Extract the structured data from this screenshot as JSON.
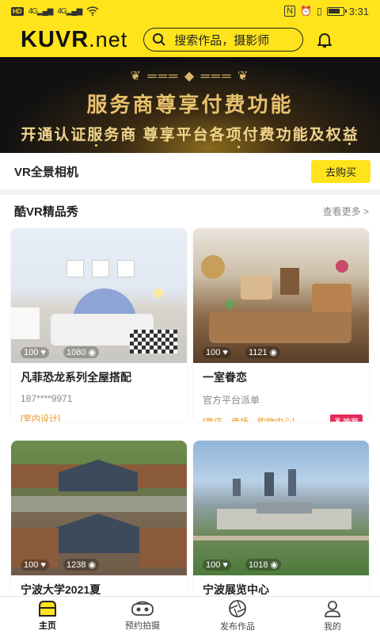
{
  "status_bar": {
    "hd": "HD",
    "signal1": "4G",
    "signal2": "4G",
    "time": "3:31"
  },
  "header": {
    "logo_main": "KUVR",
    "logo_suffix": ".net",
    "search_placeholder": "搜索作品，摄影师",
    "icons": {
      "search": "search-icon",
      "notification": "bell-icon"
    }
  },
  "banner": {
    "title": "服务商尊享付费功能",
    "subtitle": "开通认证服务商  尊享平台各项付费功能及权益"
  },
  "vr_camera": {
    "label": "VR全景相机",
    "button": "去购买"
  },
  "showcase": {
    "title": "酷VR精品秀",
    "more": "查看更多 >",
    "items": [
      {
        "name": "凡菲恐龙系列全屋搭配",
        "author": "187****9971",
        "tags": "[室内设计]",
        "likes": "100",
        "views": "1080",
        "recommended": false
      },
      {
        "name": "一室眷恋",
        "author": "官方平台派单",
        "tags": "[商店，商场，购物中心]",
        "likes": "100",
        "views": "1121",
        "recommended": true,
        "badge": "推荐"
      },
      {
        "name": "宁波大学2021夏",
        "likes": "100",
        "views": "1238"
      },
      {
        "name": "宁波展览中心",
        "likes": "100",
        "views": "1018"
      }
    ]
  },
  "nav": {
    "items": [
      {
        "label": "主页",
        "icon": "home-icon",
        "active": true
      },
      {
        "label": "预约拍摄",
        "icon": "vr-headset-icon",
        "active": false
      },
      {
        "label": "发布作品",
        "icon": "aperture-icon",
        "active": false
      },
      {
        "label": "我的",
        "icon": "user-icon",
        "active": false
      }
    ]
  },
  "colors": {
    "accent": "#ffe41c",
    "tag": "#e8961e",
    "badge": "#e52d5b"
  }
}
